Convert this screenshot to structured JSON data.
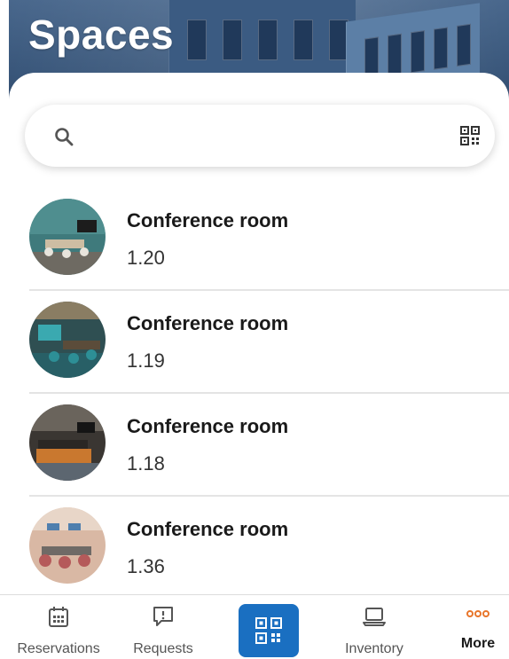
{
  "header": {
    "title": "Spaces"
  },
  "search": {
    "placeholder": "",
    "value": ""
  },
  "spaces": [
    {
      "name": "Conference room",
      "number": "1.20"
    },
    {
      "name": "Conference room",
      "number": "1.19"
    },
    {
      "name": "Conference room",
      "number": "1.18"
    },
    {
      "name": "Conference room",
      "number": "1.36"
    }
  ],
  "bottom_nav": {
    "items": [
      {
        "label": "Reservations",
        "icon": "calendar-icon",
        "active": false
      },
      {
        "label": "Requests",
        "icon": "request-alert-icon",
        "active": false
      },
      {
        "label": "",
        "icon": "qr-code-icon",
        "active": false
      },
      {
        "label": "Inventory",
        "icon": "laptop-icon",
        "active": false
      },
      {
        "label": "More",
        "icon": "more-dots-icon",
        "active": true
      }
    ]
  },
  "colors": {
    "accent_blue": "#1a6fc1",
    "more_orange": "#e8762b",
    "header_blue": "#2e4d73"
  }
}
